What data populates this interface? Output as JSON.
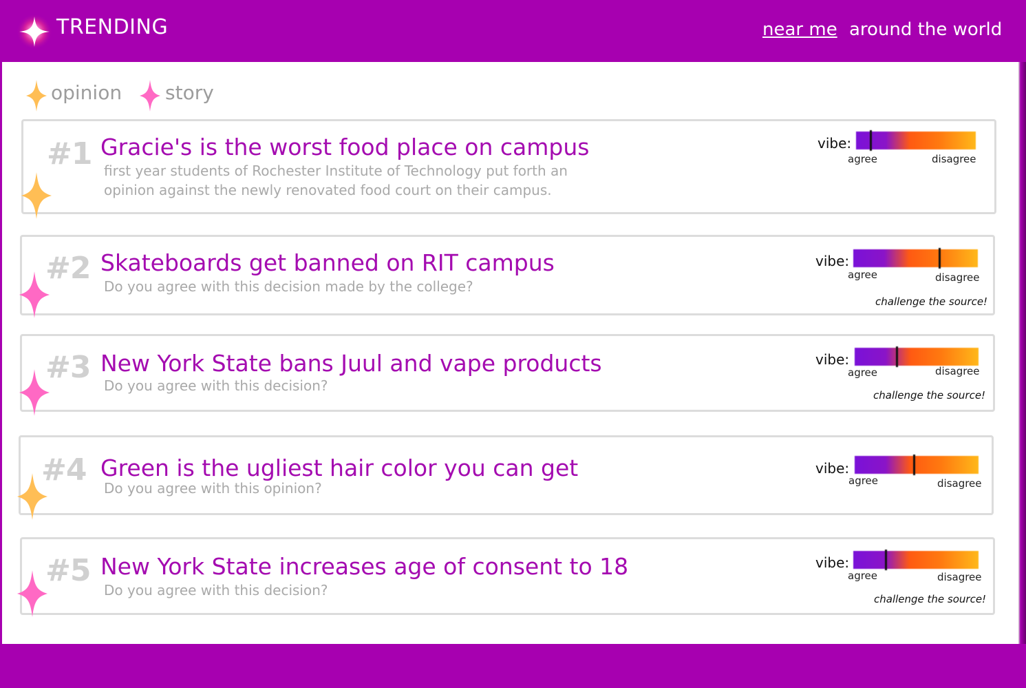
{
  "header": {
    "brand": "TRENDING",
    "nav": [
      {
        "label": "near me",
        "active": true
      },
      {
        "label": "around the world",
        "active": false
      }
    ]
  },
  "legend": [
    {
      "label": "opinion",
      "icon": "opinion-star-icon",
      "color": "#ffbe55"
    },
    {
      "label": "story",
      "icon": "story-star-icon",
      "color": "#ff69c4"
    }
  ],
  "vibe": {
    "label": "vibe:",
    "agree": "agree",
    "disagree": "disagree"
  },
  "colors": {
    "purple": "#a700b0",
    "title": "#a40bb0",
    "opinion": "#ffbe55",
    "story": "#ff69c4"
  },
  "cards": [
    {
      "rank": "#1",
      "type": "opinion",
      "title": "Gracie's is the worst food place on campus",
      "subtitle_lines": [
        "first year students of Rochester Institute of Technology put forth an",
        "opinion against the newly renovated food court on their campus."
      ],
      "vibe_fraction": 0.12,
      "challenge": ""
    },
    {
      "rank": "#2",
      "type": "story",
      "title": "Skateboards get banned on RIT campus",
      "subtitle_lines": [
        "Do you agree with this decision made by the college?"
      ],
      "vibe_fraction": 0.69,
      "challenge": "challenge the source!"
    },
    {
      "rank": "#3",
      "type": "story",
      "title": "New York State bans Juul and vape products",
      "subtitle_lines": [
        "Do you agree with this decision?"
      ],
      "vibe_fraction": 0.34,
      "challenge": "challenge the source!"
    },
    {
      "rank": "#4",
      "type": "opinion",
      "title": "Green is the ugliest hair color you can get",
      "subtitle_lines": [
        "Do you agree with this opinion?"
      ],
      "vibe_fraction": 0.48,
      "challenge": ""
    },
    {
      "rank": "#5",
      "type": "story",
      "title": "New York State increases age of consent to 18",
      "subtitle_lines": [
        "Do you agree with this decision?"
      ],
      "vibe_fraction": 0.26,
      "challenge": "challenge the source!"
    }
  ]
}
